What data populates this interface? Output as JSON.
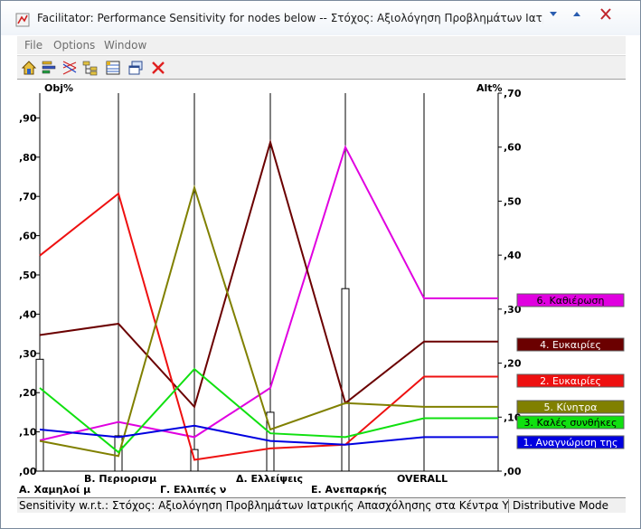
{
  "window": {
    "title": "Facilitator: Performance Sensitivity for nodes below -- Στόχος: Αξιολόγηση Προβλημάτων Ιατρικής Απ...",
    "buttons": {
      "minimize": "▼",
      "maximize": "▲",
      "close": "✕"
    }
  },
  "menu": {
    "file": "File",
    "options": "Options",
    "window": "Window"
  },
  "toolbar": [
    "home-icon",
    "bar-sort-icon",
    "scatter-icon",
    "tree-icon",
    "grid-view-icon",
    "copy-window-icon",
    "close-icon"
  ],
  "status": {
    "left": "Sensitivity w.r.t.: Στόχος: Αξιολόγηση Προβλημάτων Ιατρικής Απασχόλησης στα Κέντρα Υγε",
    "right": "Distributive Mode"
  },
  "chart_data": {
    "type": "line",
    "left_axis_label": "Obj%",
    "right_axis_label": "Alt%",
    "left_ticks": [
      ",00",
      ",10",
      ",20",
      ",30",
      ",40",
      ",50",
      ",60",
      ",70",
      ",80",
      ",90"
    ],
    "right_ticks": [
      ",00",
      ",10",
      ",20",
      ",30",
      ",40",
      ",50",
      ",60",
      ",70"
    ],
    "left_ylim": [
      0,
      1.0
    ],
    "right_ylim": [
      0,
      0.7
    ],
    "categories": [
      "Α. Χαμηλοί μ",
      "Β. Περιορισμ",
      "Γ. Ελλιπές ν",
      "Δ. Ελλείψεις",
      "Ε. Ανεπαρκής",
      "OVERALL"
    ],
    "category_label_rows": [
      1,
      0,
      1,
      0,
      1,
      0
    ],
    "objective_bars": [
      0.285,
      0.09,
      0.055,
      0.15,
      0.465
    ],
    "series": [
      {
        "name": "6. Καθιέρωση",
        "color": "#e000e0",
        "values": [
          0.057,
          0.091,
          0.063,
          0.154,
          0.6,
          0.32
        ]
      },
      {
        "name": "4. Ευκαιρίες",
        "color": "#6b0000",
        "values": [
          0.252,
          0.273,
          0.119,
          0.609,
          0.126,
          0.24
        ]
      },
      {
        "name": "2. Ευκαιρίες",
        "color": "#ee1010",
        "values": [
          0.399,
          0.514,
          0.021,
          0.042,
          0.049,
          0.175
        ]
      },
      {
        "name": "5. Κίνητρα",
        "color": "#808000",
        "values": [
          0.056,
          0.028,
          0.525,
          0.077,
          0.126,
          0.119
        ]
      },
      {
        "name": "3. Καλές συνθήκες",
        "color": "#10e010",
        "values": [
          0.154,
          0.035,
          0.189,
          0.07,
          0.063,
          0.098
        ]
      },
      {
        "name": "1. Αναγνώριση της",
        "color": "#0000e0",
        "values": [
          0.077,
          0.063,
          0.084,
          0.056,
          0.049,
          0.063
        ]
      }
    ]
  }
}
